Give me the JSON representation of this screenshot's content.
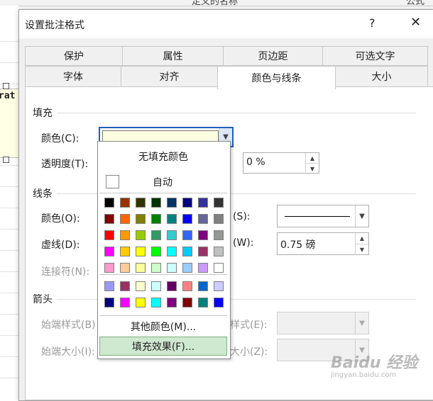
{
  "background": {
    "header_fragments": [
      "定义的名称",
      "公式审"
    ],
    "comment_text": "rat"
  },
  "dialog": {
    "title": "设置批注格式",
    "help_glyph": "?",
    "close_glyph": "✕"
  },
  "tabs_row1": [
    "保护",
    "属性",
    "页边距",
    "可选文字"
  ],
  "tabs_row2": [
    "字体",
    "对齐",
    "颜色与线条",
    "大小"
  ],
  "active_tab": "颜色与线条",
  "fill": {
    "section": "填充",
    "color_label": "颜色(C):",
    "transparency_label": "透明度(T):",
    "transparency_value": "0 %",
    "current_color": "#ffffe1"
  },
  "line": {
    "section": "线条",
    "color_label": "颜色(O):",
    "dash_label": "虚线(D):",
    "connector_label": "连接符(N):",
    "style_label": "(S):",
    "weight_label": "(W):",
    "weight_value": "0.75 磅"
  },
  "arrows": {
    "section": "箭头",
    "begin_style_label": "始端样式(B)",
    "end_style_label": "样式(E):",
    "begin_size_label": "始端大小(I):",
    "end_size_label": "大小(Z):"
  },
  "popup": {
    "no_fill": "无填充颜色",
    "auto": "自动",
    "more_colors": "其他颜色(M)...",
    "fill_effects": "填充效果(F)...",
    "palette": [
      [
        "#000000",
        "#993300",
        "#333300",
        "#003300",
        "#003366",
        "#000080",
        "#333399",
        "#333333"
      ],
      [
        "#800000",
        "#ff6600",
        "#808000",
        "#008000",
        "#008080",
        "#0000ff",
        "#666699",
        "#808080"
      ],
      [
        "#ff0000",
        "#ff9900",
        "#99cc00",
        "#339966",
        "#33cccc",
        "#3366ff",
        "#800080",
        "#969696"
      ],
      [
        "#ff00ff",
        "#ffcc00",
        "#ffff00",
        "#00ff00",
        "#00ffff",
        "#00ccff",
        "#993366",
        "#c0c0c0"
      ],
      [
        "#ff99cc",
        "#ffcc99",
        "#ffff99",
        "#ccffcc",
        "#ccffff",
        "#99ccff",
        "#cc99ff",
        "#ffffff"
      ]
    ],
    "palette_extra": [
      [
        "#9999ff",
        "#993366",
        "#ffffcc",
        "#ccffff",
        "#660066",
        "#ff8080",
        "#0066cc",
        "#ccccff"
      ],
      [
        "#000080",
        "#ff00ff",
        "#ffff00",
        "#00ffff",
        "#800080",
        "#800000",
        "#008080",
        "#0000ff"
      ]
    ]
  },
  "watermark": {
    "brand": "Baidu 经验",
    "url": "jingyan.baidu.com"
  }
}
